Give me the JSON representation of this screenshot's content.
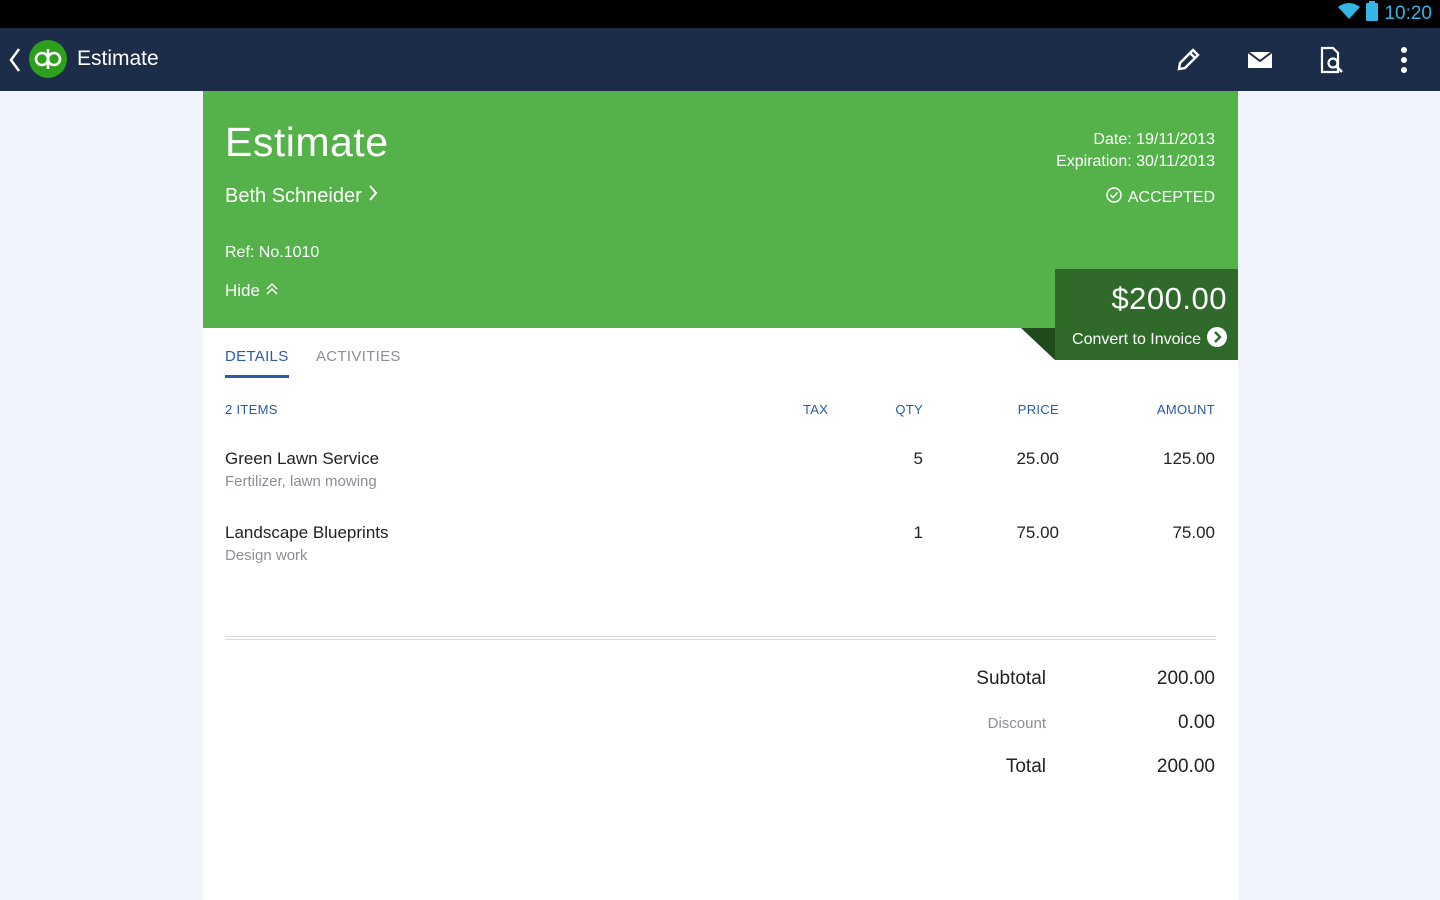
{
  "status_bar": {
    "time": "10:20"
  },
  "action_bar": {
    "title": "Estimate",
    "icons": [
      "back-chevron-icon",
      "quickbooks-logo",
      "pencil-icon",
      "mail-icon",
      "document-search-icon",
      "overflow-menu-icon"
    ]
  },
  "header": {
    "title": "Estimate",
    "customer": "Beth Schneider",
    "date": "Date: 19/11/2013",
    "expiration": "Expiration: 30/11/2013",
    "status": "ACCEPTED",
    "ref": "Ref: No.1010",
    "hide_label": "Hide",
    "amount": "$200.00",
    "convert_label": "Convert to Invoice"
  },
  "tabs": [
    {
      "label": "DETAILS",
      "active": true
    },
    {
      "label": "ACTIVITIES",
      "active": false
    }
  ],
  "table": {
    "headers": {
      "items": "2  ITEMS",
      "tax": "TAX",
      "qty": "QTY",
      "price": "PRICE",
      "amount": "AMOUNT"
    },
    "rows": [
      {
        "name": "Green Lawn Service",
        "description": "Fertilizer, lawn mowing",
        "qty": "5",
        "price": "25.00",
        "amount": "125.00"
      },
      {
        "name": "Landscape Blueprints",
        "description": "Design work",
        "qty": "1",
        "price": "75.00",
        "amount": "75.00"
      }
    ]
  },
  "totals": {
    "subtotal_label": "Subtotal",
    "subtotal": "200.00",
    "discount_label": "Discount",
    "discount": "0.00",
    "total_label": "Total",
    "total": "200.00"
  },
  "colors": {
    "action_bar": "#1c2d4a",
    "header_green": "#55b24a",
    "amount_box": "#2f6a2b",
    "accent_blue": "#2a5aa8",
    "status_blue": "#33b5e5"
  }
}
